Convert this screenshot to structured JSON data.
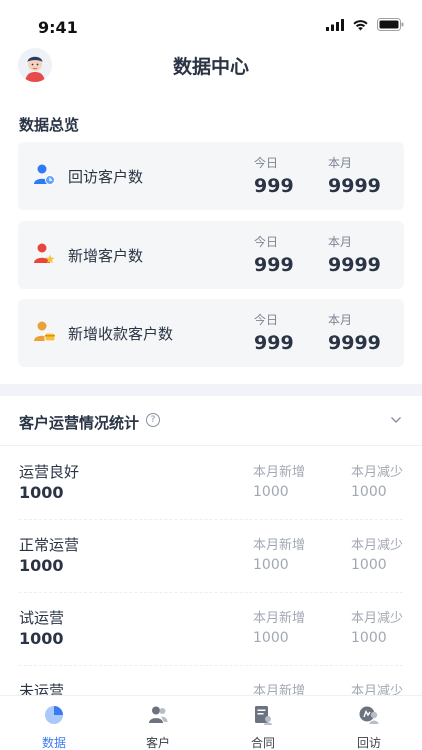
{
  "status_bar": {
    "time": "9:41"
  },
  "header": {
    "title": "数据中心"
  },
  "overview": {
    "title": "数据总览",
    "cards": [
      {
        "label": "回访客户数",
        "icon": "revisit-customer-icon",
        "today_label": "今日",
        "today_value": "999",
        "month_label": "本月",
        "month_value": "9999",
        "color": "#2f7af5"
      },
      {
        "label": "新增客户数",
        "icon": "new-customer-icon",
        "today_label": "今日",
        "today_value": "999",
        "month_label": "本月",
        "month_value": "9999",
        "color": "#e8453c"
      },
      {
        "label": "新增收款客户数",
        "icon": "payment-customer-icon",
        "today_label": "今日",
        "today_value": "999",
        "month_label": "本月",
        "month_value": "9999",
        "color": "#e9a13a"
      }
    ]
  },
  "operations": {
    "title": "客户运营情况统计",
    "help_icon": "question-circle-icon",
    "rows": [
      {
        "name": "运营良好",
        "value": "1000",
        "new_label": "本月新增",
        "new_value": "1000",
        "dec_label": "本月减少",
        "dec_value": "1000"
      },
      {
        "name": "正常运营",
        "value": "1000",
        "new_label": "本月新增",
        "new_value": "1000",
        "dec_label": "本月减少",
        "dec_value": "1000"
      },
      {
        "name": "试运营",
        "value": "1000",
        "new_label": "本月新增",
        "new_value": "1000",
        "dec_label": "本月减少",
        "dec_value": "1000"
      },
      {
        "name": "未运营",
        "value": "",
        "new_label": "本月新增",
        "new_value": "",
        "dec_label": "本月减少",
        "dec_value": ""
      }
    ]
  },
  "tabbar": {
    "active": "数据",
    "active_color": "#3a7bf2",
    "tabs": [
      {
        "label": "数据",
        "icon": "pie-chart-icon"
      },
      {
        "label": "客户",
        "icon": "customers-icon"
      },
      {
        "label": "合同",
        "icon": "contract-icon"
      },
      {
        "label": "回访",
        "icon": "revisit-icon"
      }
    ]
  }
}
